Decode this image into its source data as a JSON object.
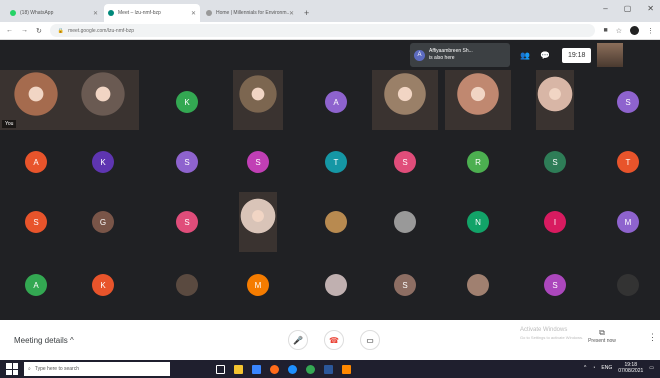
{
  "browser": {
    "tabs": [
      {
        "title": "(18) WhatsApp",
        "favicon_color": "#25d366",
        "active": false
      },
      {
        "title": "Meet – lzu-nmf-bzp",
        "favicon_color": "#00897b",
        "active": true
      },
      {
        "title": "Home | Millennials for Environm...",
        "favicon_color": "#999999",
        "active": false
      }
    ],
    "url": "meet.google.com/lzu-nmf-bzp",
    "new_tab_symbol": "+"
  },
  "meet": {
    "joined_notice": {
      "initial": "A",
      "name": "Affiyaambreen Sh...",
      "status": "is also here"
    },
    "clock": "19:18",
    "self_label": "You",
    "avatar_rows": [
      [
        {
          "type": "video",
          "bg": "#a56b4e",
          "label": "You"
        },
        {
          "type": "video",
          "bg": "#6a5a52"
        },
        {
          "type": "avatar",
          "letter": "K",
          "color": "#33a852"
        },
        {
          "type": "video",
          "bg": "#7c6650"
        },
        {
          "type": "avatar",
          "letter": "A",
          "color": "#8e63ce"
        },
        {
          "type": "video",
          "bg": "#9a8068"
        },
        {
          "type": "video",
          "bg": "#c08870"
        },
        {
          "type": "video",
          "bg": "#d8b6a6"
        },
        {
          "type": "avatar",
          "letter": "S",
          "color": "#8e63ce"
        }
      ],
      [
        {
          "type": "avatar",
          "letter": "A",
          "color": "#e8542b"
        },
        {
          "type": "avatar",
          "letter": "K",
          "color": "#5e35b1"
        },
        {
          "type": "avatar",
          "letter": "S",
          "color": "#8e63ce"
        },
        {
          "type": "avatar",
          "letter": "S",
          "color": "#c13fb5"
        },
        {
          "type": "avatar",
          "letter": "T",
          "color": "#1597a5"
        },
        {
          "type": "avatar",
          "letter": "S",
          "color": "#e04d7a"
        },
        {
          "type": "avatar",
          "letter": "R",
          "color": "#4caf50"
        },
        {
          "type": "avatar",
          "letter": "S",
          "color": "#2e7d57"
        },
        {
          "type": "avatar",
          "letter": "T",
          "color": "#e8542b"
        }
      ],
      [
        {
          "type": "avatar",
          "letter": "S",
          "color": "#e8542b"
        },
        {
          "type": "avatar",
          "letter": "G",
          "color": "#795548"
        },
        {
          "type": "avatar",
          "letter": "S",
          "color": "#e04d7a"
        },
        {
          "type": "video",
          "bg": "#d9c4b8"
        },
        {
          "type": "avatar",
          "letter": "",
          "color": "#b88a50"
        },
        {
          "type": "avatar",
          "letter": "",
          "color": "#999999"
        },
        {
          "type": "avatar",
          "letter": "N",
          "color": "#12a368"
        },
        {
          "type": "avatar",
          "letter": "I",
          "color": "#d81b60"
        },
        {
          "type": "avatar",
          "letter": "M",
          "color": "#8e63ce"
        }
      ],
      [
        {
          "type": "avatar",
          "letter": "A",
          "color": "#33a852"
        },
        {
          "type": "avatar",
          "letter": "K",
          "color": "#e8542b"
        },
        {
          "type": "avatar",
          "letter": "",
          "color": "#5a4a40"
        },
        {
          "type": "avatar",
          "letter": "M",
          "color": "#f57c00"
        },
        {
          "type": "avatar",
          "letter": "",
          "color": "#c0b0b0"
        },
        {
          "type": "avatar",
          "letter": "S",
          "color": "#8d6e63"
        },
        {
          "type": "avatar",
          "letter": "",
          "color": "#a08070"
        },
        {
          "type": "avatar",
          "letter": "S",
          "color": "#ab47bc"
        },
        {
          "type": "avatar",
          "letter": "",
          "color": "#333333"
        }
      ]
    ]
  },
  "bottom_bar": {
    "meeting_details": "Meeting details ^",
    "activate_windows": "Activate Windows",
    "activate_sub": "Go to Settings to activate Windows.",
    "present_now": "Present now"
  },
  "taskbar": {
    "search_placeholder": "Type here to search",
    "time": "19:18",
    "date": "07/08/2021",
    "lang": "ENG"
  },
  "colors": {
    "meet_bg": "#202124",
    "end_call": "#ea4335"
  }
}
